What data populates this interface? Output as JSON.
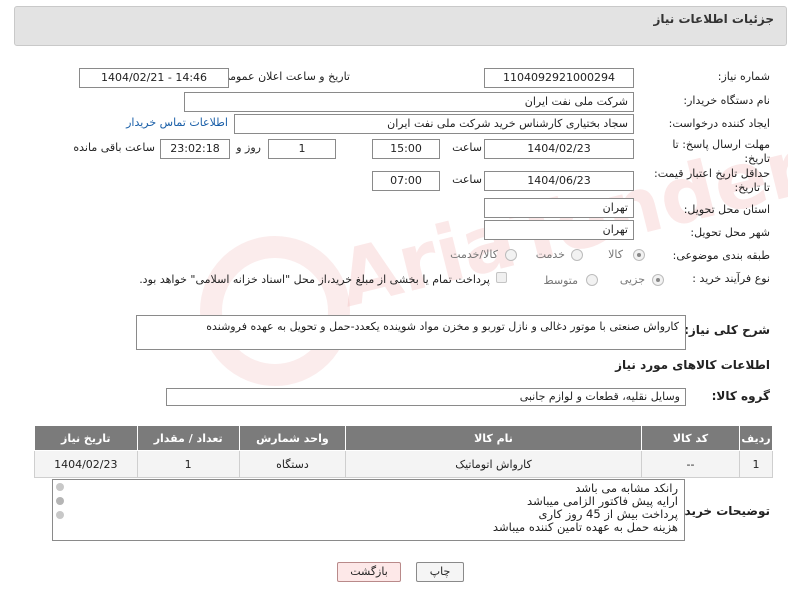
{
  "header": {
    "title": "جزئیات اطلاعات نیاز"
  },
  "form": {
    "need_number_label": "شماره نیاز:",
    "need_number": "1104092921000294",
    "announce_label": "تاریخ و ساعت اعلان عمومی:",
    "announce_value": "1404/02/21 - 14:46",
    "buyer_org_label": "نام دستگاه خریدار:",
    "buyer_org": "شرکت ملی نفت ایران",
    "requester_label": "ایجاد کننده درخواست:",
    "requester": "سجاد بختیاری کارشناس خرید شرکت ملی نفت ایران",
    "contact_link": "اطلاعات تماس خریدار",
    "deadline_label_1": "مهلت ارسال پاسخ: تا",
    "deadline_label_2": "تاریخ:",
    "deadline_date": "1404/02/23",
    "time_label": "ساعت",
    "deadline_time": "15:00",
    "days_value": "1",
    "days_label": "روز و",
    "remaining_value": "23:02:18",
    "remaining_label": "ساعت باقی مانده",
    "validity_label_1": "حداقل تاریخ اعتبار قیمت:",
    "validity_label_2": "تا تاریخ:",
    "validity_date": "1404/06/23",
    "validity_time": "07:00",
    "province_label": "استان محل تحویل:",
    "province": "تهران",
    "city_label": "شهر محل تحویل:",
    "city": "تهران",
    "category_label": "طبقه بندی موضوعی:",
    "category_options": [
      "کالا",
      "خدمت",
      "کالا/خدمت"
    ],
    "process_label": "نوع فرآیند خرید :",
    "process_options": [
      "جزیی",
      "متوسط"
    ],
    "payment_note": "پرداخت تمام یا بخشی از مبلغ خرید،از محل \"اسناد خزانه اسلامی\" خواهد بود.",
    "description_label": "شرح کلی نیاز:",
    "description": "کارواش صنعتی با موتور دغالی و نازل توربو و مخزن مواد شوینده یکعدد-حمل و تحویل به عهده فروشنده"
  },
  "goods_section": {
    "title": "اطلاعات کالاهای مورد نیاز",
    "group_label": "گروه کالا:",
    "group_value": "وسایل نقلیه، قطعات و لوازم جانبی",
    "columns": [
      "ردیف",
      "کد کالا",
      "نام کالا",
      "واحد شمارش",
      "تعداد / مقدار",
      "تاریخ نیاز"
    ],
    "rows": [
      {
        "row": "1",
        "code": "--",
        "name": "کارواش اتوماتیک",
        "unit": "دستگاه",
        "qty": "1",
        "date": "1404/02/23"
      }
    ]
  },
  "buyer_notes": {
    "label": "توضیحات خریدار:",
    "lines": [
      "رانکد مشابه می باشد",
      "ارایه پیش فاکتور الزامی میباشد",
      "پرداخت بیش از 45 روز کاری",
      "هزینه حمل به عهده تامین کننده میباشد"
    ]
  },
  "buttons": {
    "print": "چاپ",
    "back": "بازگشت"
  },
  "watermark": "AriaTender.net"
}
